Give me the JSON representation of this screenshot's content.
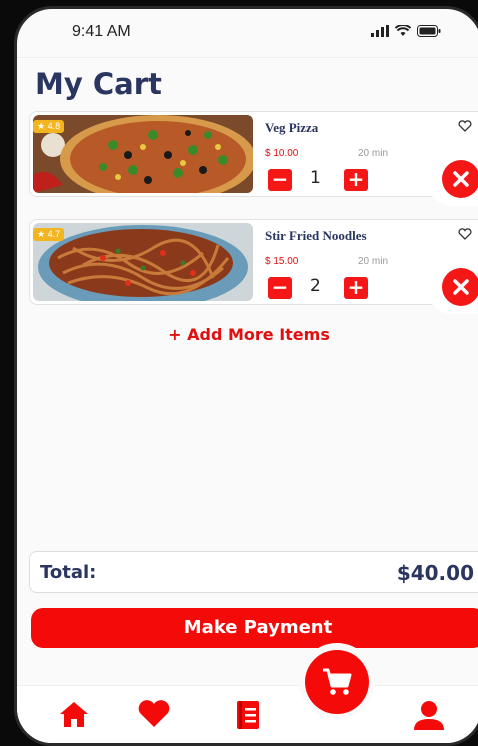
{
  "status_bar": {
    "time": "9:41 AM"
  },
  "page_title": "My Cart",
  "cart_items": [
    {
      "name": "Veg Pizza",
      "rating": "4.8",
      "price": "$ 10.00",
      "time": "20 min",
      "quantity": "1"
    },
    {
      "name": "Stir Fried Noodles",
      "rating": "4.7",
      "price": "$ 15.00",
      "time": "20 min",
      "quantity": "2"
    }
  ],
  "add_more_label": "+ Add More Items",
  "total": {
    "label": "Total:",
    "value": "$40.00"
  },
  "payment_button": "Make Payment",
  "colors": {
    "accent": "#f50a0a",
    "title": "#2a3560",
    "rating": "#f2b51f"
  },
  "icons": [
    "signal-icon",
    "wifi-icon",
    "battery-icon",
    "heart-outline-icon",
    "minus-icon",
    "plus-icon",
    "close-icon",
    "home-icon",
    "heart-icon",
    "cart-icon",
    "menu-book-icon",
    "user-icon",
    "star-icon"
  ]
}
